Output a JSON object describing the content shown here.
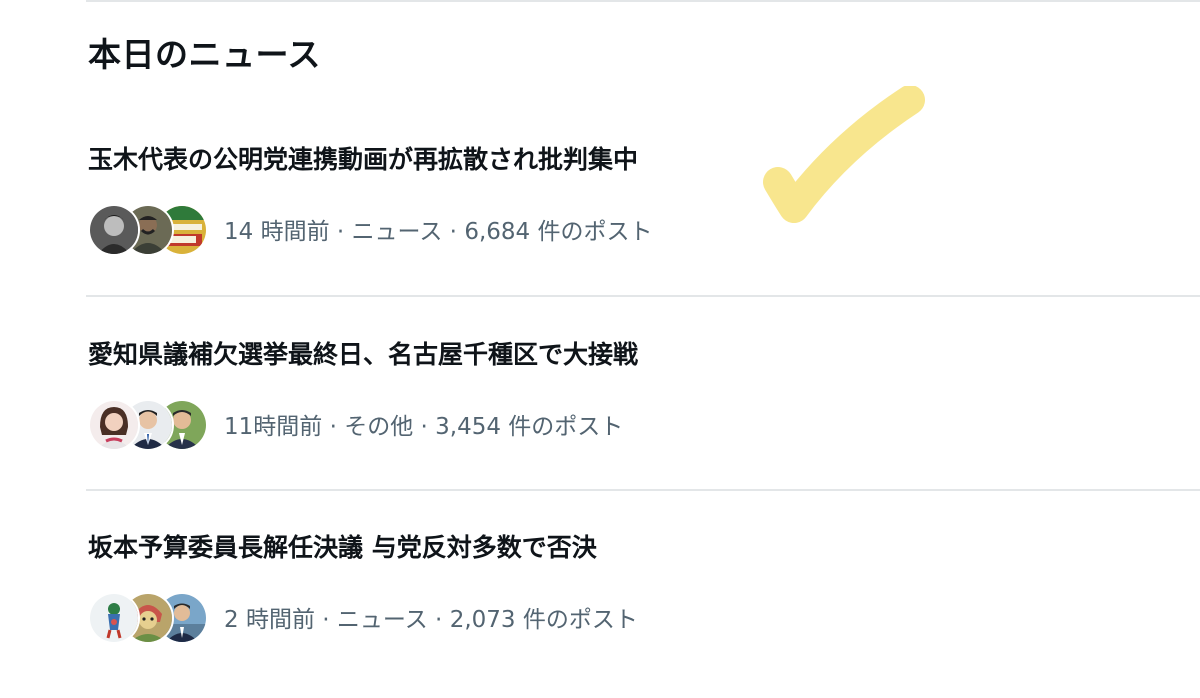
{
  "section": {
    "title": "本日のニュース"
  },
  "news": [
    {
      "headline": "玉木代表の公明党連携動画が再拡散され批判集中",
      "time": "14 時間前",
      "category": "ニュース",
      "posts": "6,684 件のポスト",
      "separator": " · "
    },
    {
      "headline": "愛知県議補欠選挙最終日、名古屋千種区で大接戦",
      "time": "11時間前",
      "category": "その他",
      "posts": "3,454 件のポスト",
      "separator": " · "
    },
    {
      "headline": "坂本予算委員長解任決議 与党反対多数で否決",
      "time": "2 時間前",
      "category": "ニュース",
      "posts": "2,073 件のポスト",
      "separator": " · "
    }
  ],
  "colors": {
    "meta_text": "#536471",
    "divider": "#e3e6e8",
    "highlight": "#f7e27a"
  }
}
